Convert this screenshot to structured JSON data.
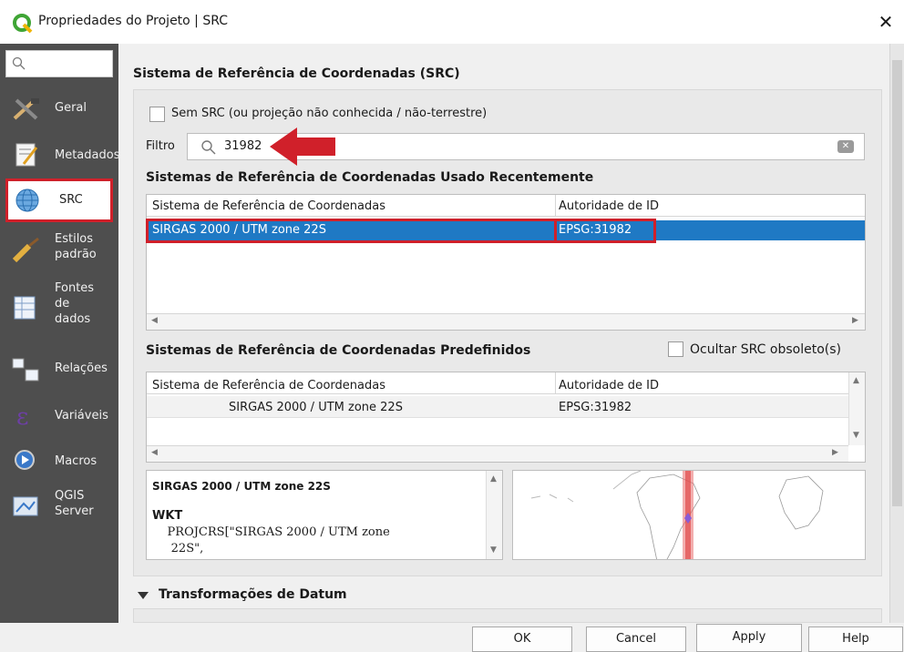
{
  "window": {
    "title": "Propriedades do Projeto | SRC",
    "close_symbol": "✕"
  },
  "sidebar": {
    "search_placeholder": "",
    "items": [
      {
        "label": "Geral",
        "icon": "tools-icon"
      },
      {
        "label": "Metadados",
        "icon": "metadata-icon"
      },
      {
        "label": "SRC",
        "icon": "globe-icon",
        "selected": true
      },
      {
        "label": "Estilos\npadrão",
        "icon": "brush-icon"
      },
      {
        "label": "Fontes\nde\ndados",
        "icon": "datasource-icon"
      },
      {
        "label": "Relações",
        "icon": "relations-icon"
      },
      {
        "label": "Variáveis",
        "icon": "variables-icon"
      },
      {
        "label": "Macros",
        "icon": "macros-icon"
      },
      {
        "label": "QGIS\nServer",
        "icon": "server-icon"
      }
    ]
  },
  "main": {
    "heading": "Sistema de Referência de Coordenadas (SRC)",
    "no_crs_label": "Sem SRC (ou projeção não conhecida / não-terrestre)",
    "filter_label": "Filtro",
    "filter_value": "31982",
    "recent": {
      "heading": "Sistemas de Referência de Coordenadas Usado Recentemente",
      "columns": [
        "Sistema de Referência de Coordenadas",
        "Autoridade de ID"
      ],
      "rows": [
        {
          "name": "SIRGAS 2000 / UTM zone 22S",
          "id": "EPSG:31982"
        }
      ]
    },
    "predefined": {
      "heading": "Sistemas de Referência de Coordenadas Predefinidos",
      "hide_deprecated_label": "Ocultar SRC obsoleto(s)",
      "columns": [
        "Sistema de Referência de Coordenadas",
        "Autoridade de ID"
      ],
      "rows": [
        {
          "name": "SIRGAS 2000 / UTM zone 22S",
          "id": "EPSG:31982"
        }
      ]
    },
    "wkt": {
      "title": "SIRGAS 2000 / UTM zone 22S",
      "label": "WKT",
      "line1": "    PROJCRS[\"SIRGAS 2000 / UTM zone",
      "line2": "     22S\","
    },
    "datum_transform_label": "Transformações de Datum"
  },
  "footer": {
    "ok": "OK",
    "cancel": "Cancel",
    "apply": "Apply",
    "help": "Help"
  },
  "colors": {
    "accent_red": "#d0202a",
    "selection_blue": "#1f79c4",
    "sidebar_bg": "#4e4e4e"
  }
}
